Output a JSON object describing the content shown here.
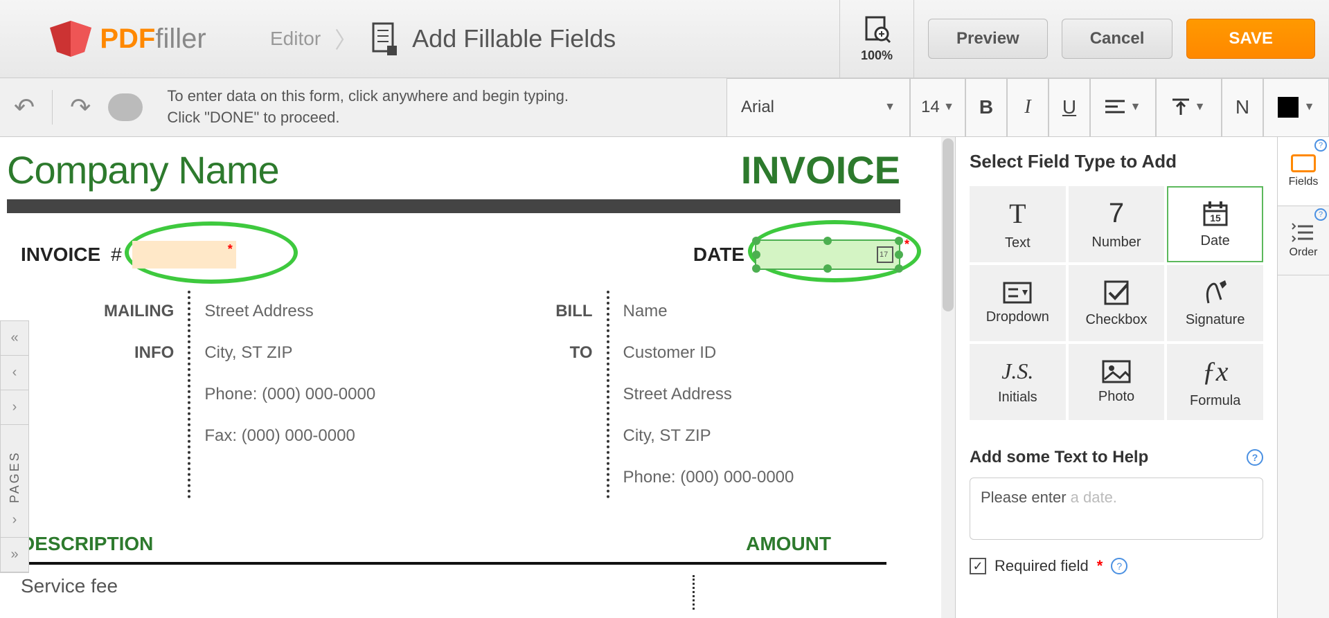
{
  "header": {
    "logo_pdf": "PDF",
    "logo_filler": "filler",
    "editor_label": "Editor",
    "page_title": "Add Fillable Fields",
    "zoom": "100%",
    "preview": "Preview",
    "cancel": "Cancel",
    "save": "SAVE"
  },
  "toolbar": {
    "hint_line1": "To enter data on this form, click anywhere and begin typing.",
    "hint_line2": "Click \"DONE\" to proceed.",
    "font": "Arial",
    "size": "14",
    "bold": "B",
    "italic": "I",
    "underline": "U",
    "n_btn": "N"
  },
  "invoice": {
    "company_name": "Company Name",
    "title": "INVOICE",
    "invoice_label": "INVOICE",
    "hash": "#",
    "date_label": "DATE",
    "mailing_label": "MAILING",
    "info_label": "INFO",
    "bill_label": "BILL",
    "to_label": "TO",
    "mailing": {
      "street": "Street Address",
      "city": "City, ST ZIP",
      "phone": "Phone: (000) 000-0000",
      "fax": "Fax: (000) 000-0000"
    },
    "billto": {
      "name": "Name",
      "customer": "Customer ID",
      "street": "Street Address",
      "city": "City, ST ZIP",
      "phone": "Phone: (000) 000-0000"
    },
    "desc_header": "DESCRIPTION",
    "amount_header": "AMOUNT",
    "service_fee": "Service fee"
  },
  "rightPanel": {
    "heading": "Select Field Type to Add",
    "tiles": {
      "text": "Text",
      "number": "Number",
      "date": "Date",
      "dropdown": "Dropdown",
      "checkbox": "Checkbox",
      "signature": "Signature",
      "initials": "Initials",
      "photo": "Photo",
      "formula": "Formula"
    },
    "help_heading": "Add some Text to Help",
    "help_prefix": "Please enter ",
    "help_suffix": "a date.",
    "required_label": "Required field",
    "tab_fields": "Fields",
    "tab_order": "Order"
  },
  "pages_label": "PAGES"
}
